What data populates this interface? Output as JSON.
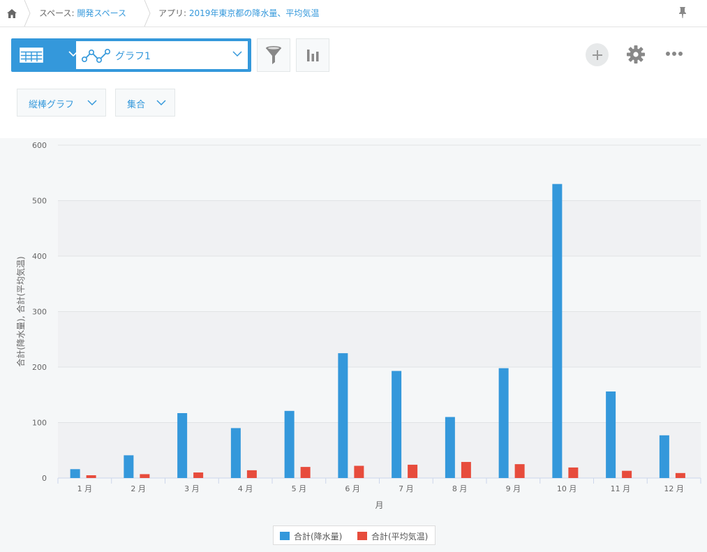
{
  "breadcrumb": {
    "space_prefix": "スペース: ",
    "space_name": "開発スペース",
    "app_prefix": "アプリ: ",
    "app_name": "2019年東京都の降水量、平均気温"
  },
  "toolbar": {
    "graph_name": "グラフ1",
    "chart_type_label": "縦棒グラフ",
    "aggregation_label": "集合"
  },
  "colors": {
    "accent": "#3498db",
    "series1": "#3498db",
    "series2": "#e74c3c"
  },
  "chart_data": {
    "type": "bar",
    "categories": [
      "1 月",
      "2 月",
      "3 月",
      "4 月",
      "5 月",
      "6 月",
      "7 月",
      "8 月",
      "9 月",
      "10 月",
      "11 月",
      "12 月"
    ],
    "series": [
      {
        "name": "合計(降水量)",
        "color": "#3498db",
        "values": [
          16,
          41,
          117,
          90,
          121,
          225,
          193,
          110,
          198,
          530,
          156,
          77
        ]
      },
      {
        "name": "合計(平均気温)",
        "color": "#e74c3c",
        "values": [
          5,
          7,
          10,
          14,
          20,
          22,
          24,
          29,
          25,
          19,
          13,
          9
        ]
      }
    ],
    "ylim": [
      0,
      600
    ],
    "yticks": [
      0,
      100,
      200,
      300,
      400,
      500,
      600
    ],
    "xlabel": "月",
    "ylabel": "合計(降水量), 合計(平均気温)",
    "legend_position": "bottom"
  }
}
